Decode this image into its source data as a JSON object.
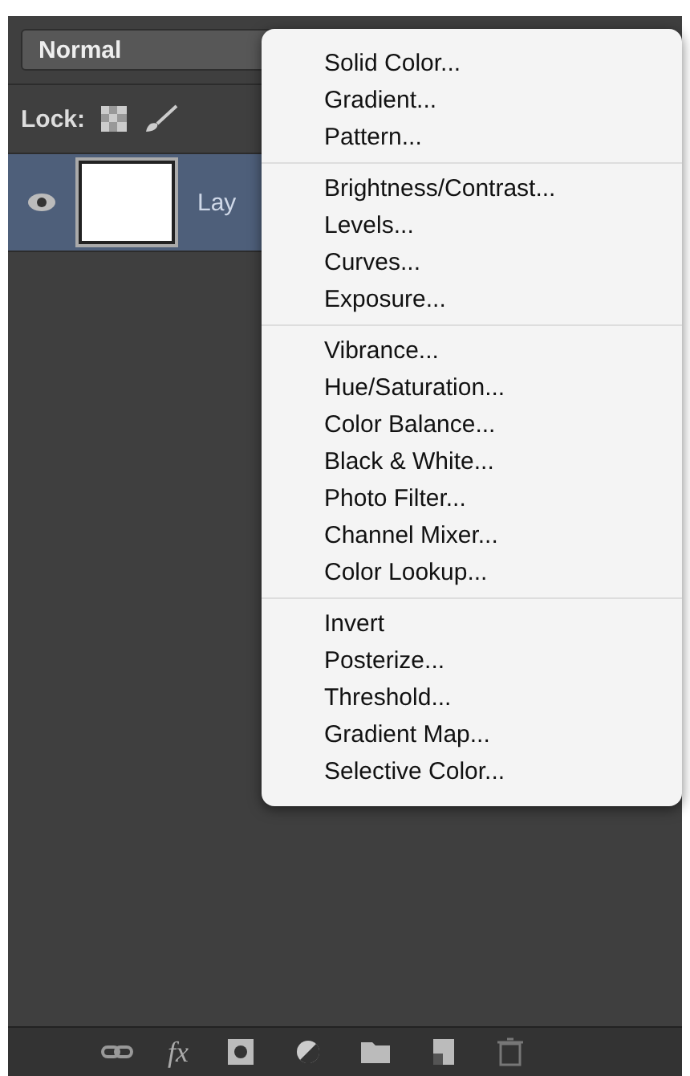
{
  "blend_mode": {
    "value": "Normal"
  },
  "lock": {
    "label": "Lock:"
  },
  "layers": [
    {
      "name": "Lay",
      "visible": true,
      "selected": true
    }
  ],
  "menu": {
    "groups": [
      [
        "Solid Color...",
        "Gradient...",
        "Pattern..."
      ],
      [
        "Brightness/Contrast...",
        "Levels...",
        "Curves...",
        "Exposure..."
      ],
      [
        "Vibrance...",
        "Hue/Saturation...",
        "Color Balance...",
        "Black & White...",
        "Photo Filter...",
        "Channel Mixer...",
        "Color Lookup..."
      ],
      [
        "Invert",
        "Posterize...",
        "Threshold...",
        "Gradient Map...",
        "Selective Color..."
      ]
    ]
  },
  "toolbar": {
    "fx": "fx"
  }
}
